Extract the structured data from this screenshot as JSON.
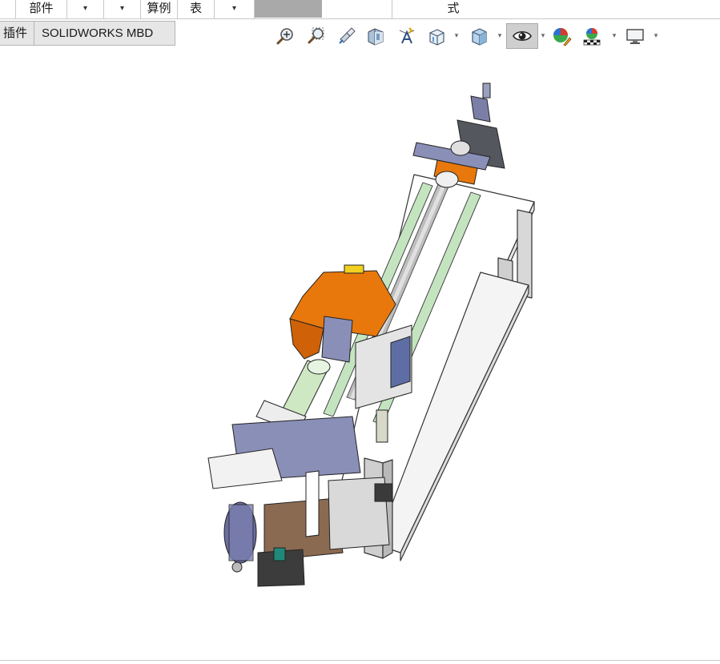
{
  "ribbon": {
    "parts_label": "部件",
    "formula_label": "算例",
    "table_label": "表",
    "style_label": "式",
    "dropdown_glyph": "▾"
  },
  "tabs": [
    {
      "label": "插件"
    },
    {
      "label": "SOLIDWORKS MBD"
    }
  ],
  "view_toolbar": {
    "icons": [
      "zoom-to-fit-icon",
      "zoom-to-area-icon",
      "previous-view-icon",
      "section-view-icon",
      "dynamic-annotation-views-icon",
      "view-orientation-icon",
      "display-style-icon",
      "hide-show-items-icon",
      "edit-appearance-icon",
      "apply-scene-icon",
      "view-settings-icon"
    ],
    "pressed_icon": "hide-show-items-icon"
  },
  "model": {
    "description_colors": {
      "frame": "#ffffff",
      "carriage": "#e8780c",
      "green_tube": "#cfe8c4",
      "brown_plate": "#8b6a52",
      "machine_blue": "#8a8fb8",
      "motor_dark": "#3c3c3c"
    }
  }
}
